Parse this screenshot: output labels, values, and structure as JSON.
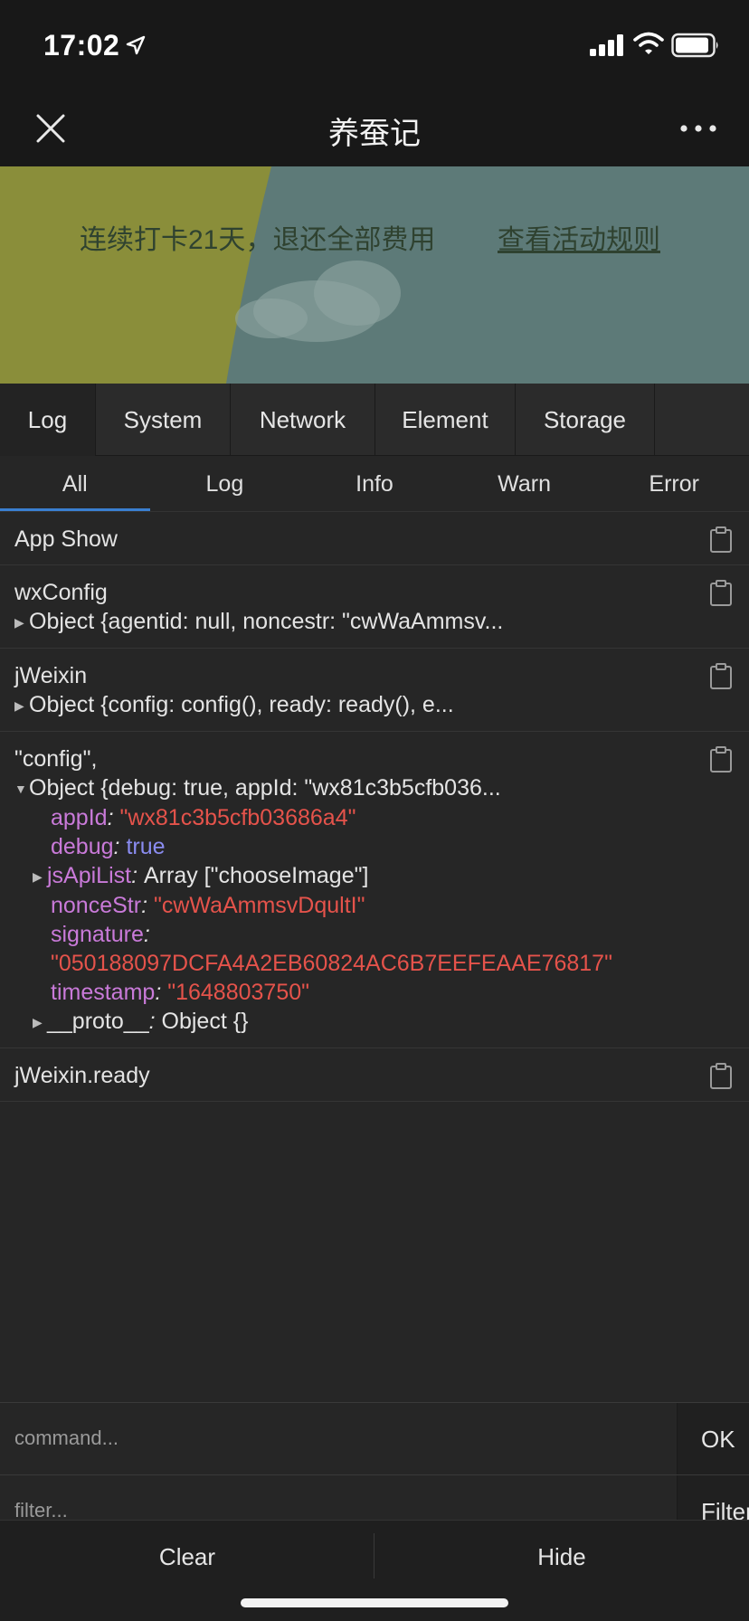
{
  "status": {
    "time": "17:02"
  },
  "nav": {
    "title": "养蚕记"
  },
  "banner": {
    "text": "连续打卡21天，退还全部费用",
    "link": "查看活动规则"
  },
  "top_tabs": [
    "Log",
    "System",
    "Network",
    "Element",
    "Storage"
  ],
  "sub_tabs": [
    "All",
    "Log",
    "Info",
    "Warn",
    "Error"
  ],
  "logs": {
    "app_show": "App Show",
    "wxconfig_title": "wxConfig",
    "wxconfig_obj": "Object {agentid: null, noncestr: \"cwWaAmmsv...",
    "jweixin_title": "jWeixin",
    "jweixin_obj": "Object {config: config(), ready: ready(), e...",
    "config_title": "\"config\",",
    "config_obj": "Object {debug: true, appId: \"wx81c3b5cfb036...",
    "fields": {
      "appId_key": "appId",
      "appId_val": "\"wx81c3b5cfb03686a4\"",
      "debug_key": "debug",
      "debug_val": "true",
      "jsApiList_key": "jsApiList",
      "jsApiList_val": "Array [\"chooseImage\"]",
      "nonceStr_key": "nonceStr",
      "nonceStr_val": "\"cwWaAmmsvDqultI\"",
      "signature_key": "signature",
      "signature_val": "\"050188097DCFA4A2EB60824AC6B7EEFEAAE76817\"",
      "timestamp_key": "timestamp",
      "timestamp_val": "\"1648803750\"",
      "proto_key": "__proto__",
      "proto_val": "Object {}"
    },
    "ready": "jWeixin.ready"
  },
  "command": {
    "placeholder": "command...",
    "ok": "OK"
  },
  "filter": {
    "placeholder": "filter...",
    "button": "Filter"
  },
  "bottom": {
    "clear": "Clear",
    "hide": "Hide"
  },
  "colors": {
    "accent": "#3a7fd0",
    "string": "#e5534b",
    "key": "#c97ad9",
    "bool": "#8a8cf0"
  }
}
